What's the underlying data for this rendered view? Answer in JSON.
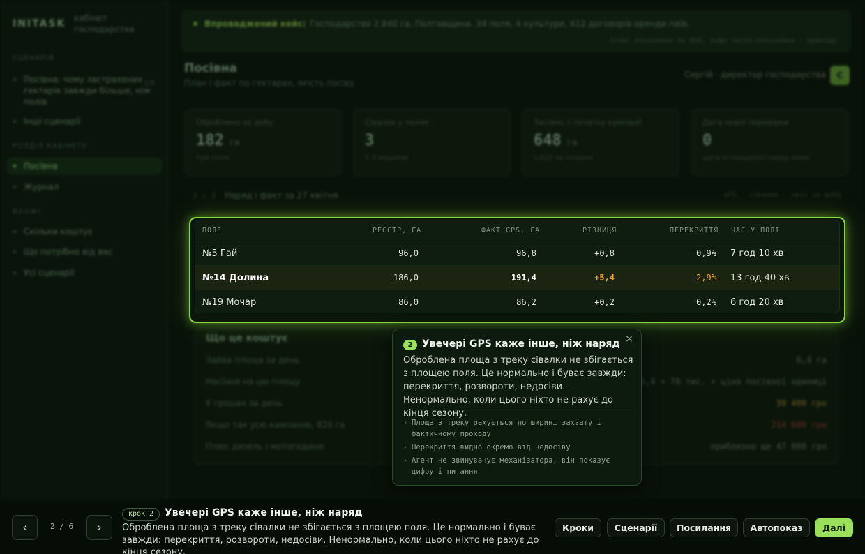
{
  "brand": {
    "name": "INITASK",
    "subtitle": "кабінет господарства"
  },
  "sidebar": {
    "sections": [
      {
        "label": "Сценарій"
      },
      {
        "label": "Розділ кабінету"
      },
      {
        "label": "Вхожі"
      }
    ],
    "items": [
      {
        "label": "Посівна: чому застрахених гектарів завжди більше, ніж полів",
        "count": "1/4"
      },
      {
        "label": "Інші сценарії"
      },
      {
        "label": "Посівна"
      },
      {
        "label": "Журнал"
      },
      {
        "label": "Скільки коштує"
      },
      {
        "label": "Що потрібно від вас"
      },
      {
        "label": "Усі сценарії"
      }
    ]
  },
  "banner": {
    "label": "Впроваджений кейс:",
    "text": "Господарство 2 840 га, Полтавщина. 34 поля, 4 культури, 412 договорів оренди паїв.",
    "meta": "схожі показники за 800, кафе число-показника   · приклад"
  },
  "page": {
    "title": "Посівна",
    "subtitle": "План і факт по гектарах, якість посіву"
  },
  "user": {
    "name": "Сергій · директор господарства",
    "initial": "С"
  },
  "stats": [
    {
      "label": "Оброблено за добу",
      "value": "182",
      "unit": "га",
      "foot": "три поля"
    },
    {
      "label": "Сівалок у полях",
      "value": "3",
      "unit": "",
      "foot": "1-3 машини"
    },
    {
      "label": "Засіяно з початку кампанії",
      "value": "648",
      "unit": "га",
      "foot": "з 820 за планом"
    },
    {
      "label": "Дата нової перевірки",
      "value": "0",
      "unit": "",
      "foot": "дата оголошеної серед лінок"
    }
  ],
  "section": {
    "num": "2 / 3",
    "title": "Наряд і факт за 27 квітня",
    "meta": "GPS · сівалки · звіт за добу"
  },
  "table": {
    "headers": [
      "Поле",
      "Реєстр, га",
      "Факт GPS, га",
      "Різниця",
      "Перекриття",
      "Час у полі"
    ],
    "rows": [
      {
        "field": "№5 Гай",
        "registry": "96,0",
        "gps": "96,8",
        "diff": "+0,8",
        "overlap": "0,9%",
        "time": "7 год 10 хв"
      },
      {
        "field": "№14 Долина",
        "registry": "186,0",
        "gps": "191,4",
        "diff": "+5,4",
        "overlap": "2,9%",
        "time": "13 год 40 хв"
      },
      {
        "field": "№19 Мочар",
        "registry": "86,0",
        "gps": "86,2",
        "diff": "+0,2",
        "overlap": "0,2%",
        "time": "6 год 20 хв"
      }
    ],
    "warn_color": "#e8a92e"
  },
  "cost": {
    "title": "Що це коштує",
    "rows": [
      {
        "label": "Зайва площа за день",
        "value": "6,4 га"
      },
      {
        "label": "Насіння на цю площу",
        "value": "6,4 × 70 тис. × ціна посівної одиниці"
      },
      {
        "label": "У грошах за день",
        "value": "39 400 грн"
      },
      {
        "label": "Якщо так усю кампанію, 820 га",
        "value": "214 600 грн"
      },
      {
        "label": "Плюс дизель і мотогодини",
        "value": "приблизно ще 47 000 грн"
      }
    ]
  },
  "tooltip": {
    "step": "2",
    "title": "Увечері GPS каже інше, ніж наряд",
    "close": "×",
    "body": "Оброблена площа з треку сівалки не збігається з площею поля. Це нормально і буває завжди: перекриття, розвороти, недосіви. Ненормально, коли цього ніхто не рахує до кінця сезону.",
    "bullets": [
      "Площа з треку рахується по ширині захвату і фактичному проходу",
      "Перекриття видно окремо від недосіву",
      "Агент не звинувачує механізатора, він показує цифру і питання"
    ]
  },
  "tour": {
    "prev": "‹",
    "next": "›",
    "pager": "2 / 6",
    "step_pill": "крок 2",
    "title": "Увечері GPS каже інше, ніж наряд",
    "body": "Оброблена площа з треку сівалки не збігається з площею поля. Це нормально і буває завжди: перекриття, розвороти, недосіви. Ненормально, коли цього ніхто не рахує до кінця сезону.",
    "actions": {
      "steps": "Кроки",
      "scenarios": "Сценарії",
      "links": "Посилання",
      "autoplay": "Автопоказ",
      "next": "Далі"
    },
    "accent": "#9be05a"
  }
}
